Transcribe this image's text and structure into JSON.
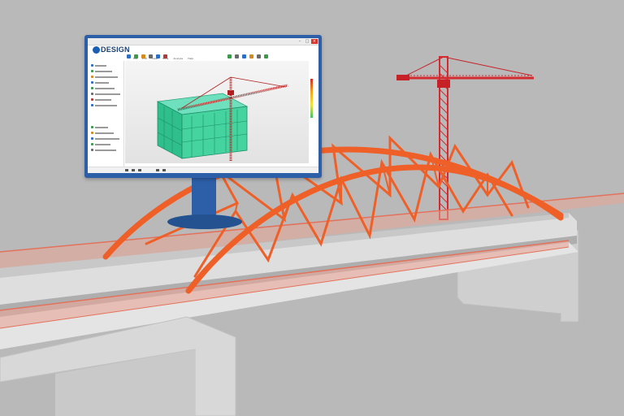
{
  "app": {
    "title": "DESIGN",
    "menu": [
      "File",
      "Edit",
      "View",
      "Tools",
      "Analyze",
      "Help"
    ],
    "toolbar_icons": [
      "select-icon",
      "move-icon",
      "rotate-icon",
      "zoom-icon",
      "pan-icon",
      "measure-icon",
      "render-icon",
      "settings-icon",
      "grid-icon",
      "layers-icon",
      "camera-icon",
      "export-icon"
    ],
    "sidebar_items": [
      "model-tree",
      "structure",
      "foundation",
      "beams",
      "columns",
      "slabs",
      "crane",
      "loads",
      "analysis",
      "materials",
      "results",
      "reports",
      "export"
    ],
    "window_controls": {
      "close": "×",
      "maximize": "□",
      "minimize": "–"
    },
    "legend_colors": [
      "#d62828",
      "#f2a51a",
      "#f3e33a",
      "#3fc26a"
    ]
  },
  "scene": {
    "subjects": [
      "bridge-deck",
      "steel-arch",
      "tower-crane",
      "computer-monitor"
    ],
    "colors": {
      "background": "#b9b9b9",
      "arch": "#ef6028",
      "crane": "#d52a2f",
      "deck": "#d8d8d8",
      "pier": "#d4d4d4",
      "railing": "#e2725b",
      "monitor": "#2d5fa8",
      "building": "#3fcf9a"
    }
  }
}
